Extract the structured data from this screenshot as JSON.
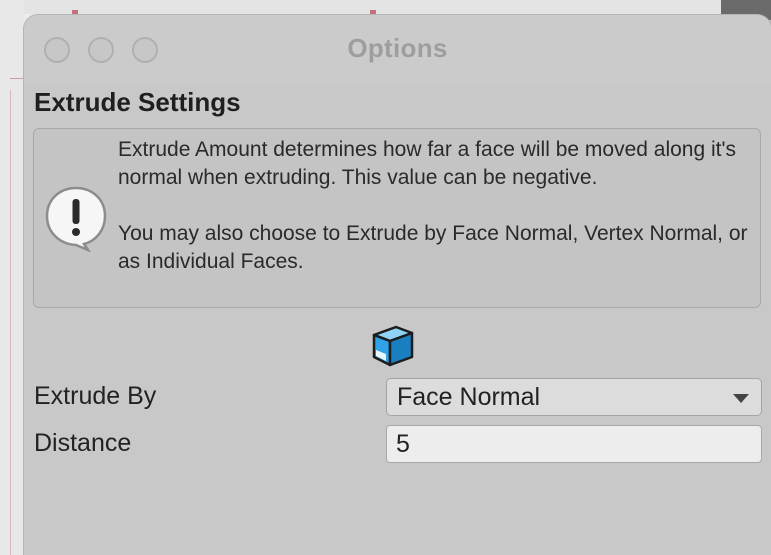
{
  "window": {
    "title": "Options"
  },
  "section": {
    "title": "Extrude Settings"
  },
  "help": {
    "icon": "exclamation-speech-icon",
    "paragraph1": "Extrude Amount determines how far a face will be moved along it's normal when extruding.  This value can be negative.",
    "paragraph2": "You may also choose to Extrude by Face Normal, Vertex Normal, or as Individual Faces."
  },
  "preview": {
    "icon": "extrude-cube-icon"
  },
  "fields": {
    "extrude_by": {
      "label": "Extrude By",
      "value": "Face Normal"
    },
    "distance": {
      "label": "Distance",
      "value": "5"
    }
  },
  "colors": {
    "window_bg": "#c8c8c8",
    "accent_blue": "#2ea3e8"
  }
}
